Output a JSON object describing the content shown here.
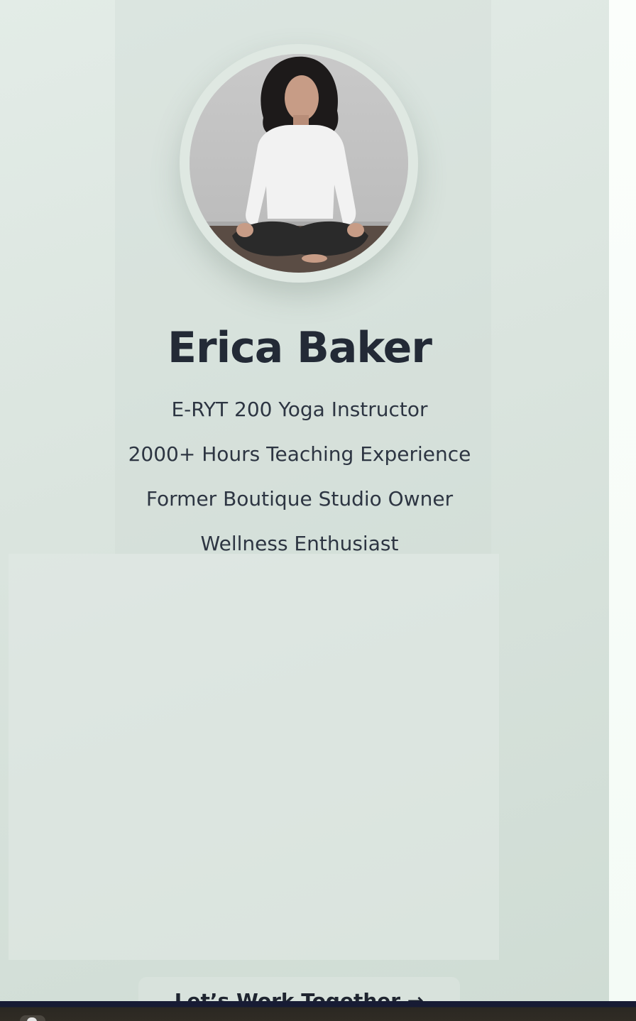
{
  "profile": {
    "name": "Erica Baker",
    "avatar_icon": "profile-photo",
    "credentials": [
      "E-RYT 200 Yoga Instructor",
      "2000+ Hours Teaching Experience",
      "Former Boutique Studio Owner",
      "Wellness Enthusiast"
    ]
  },
  "cta": {
    "label": "Let’s Work Together →"
  },
  "taskbar": {
    "icon": "app-launcher-icon"
  },
  "colors": {
    "panel_background": "#dae4de",
    "heading_text": "#232a36",
    "body_text": "#2d3542",
    "avatar_ring": "#dfe8e2",
    "taskbar": "#171b34"
  }
}
